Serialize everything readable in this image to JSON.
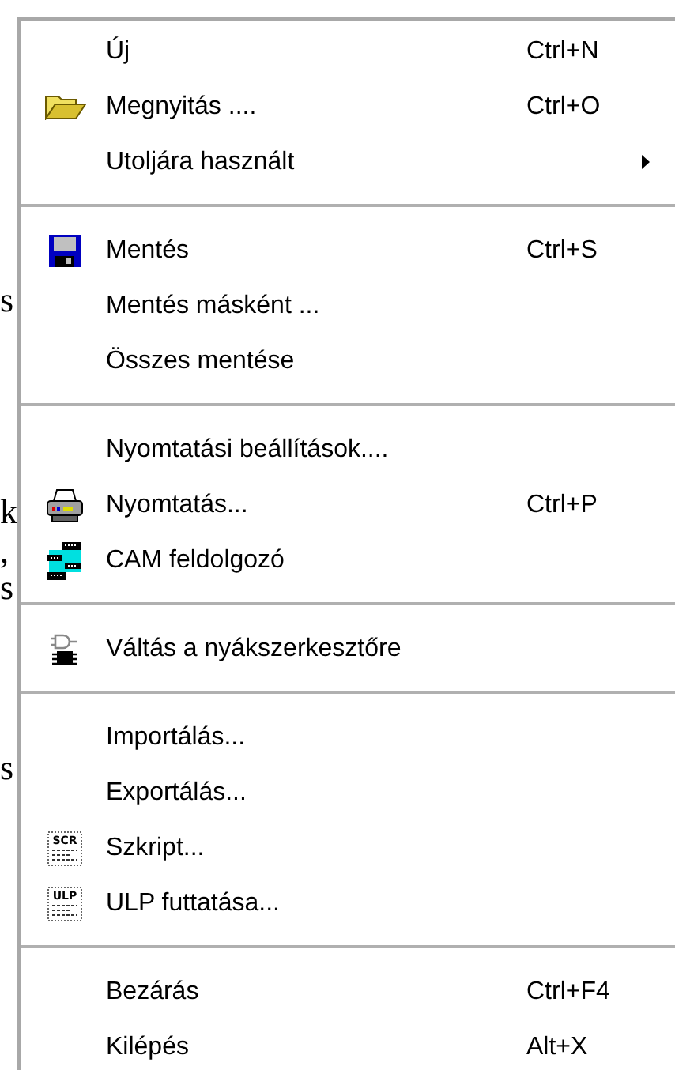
{
  "background_text": [
    "s",
    "k",
    ",",
    "s",
    "s"
  ],
  "menu": {
    "groups": [
      [
        {
          "label": "Új",
          "shortcut": "Ctrl+N",
          "has_submenu": false
        },
        {
          "label": "Megnyitás ....",
          "shortcut": "Ctrl+O",
          "has_submenu": false,
          "kind": "folder"
        },
        {
          "label": "Utoljára használt",
          "has_submenu": true
        }
      ],
      [
        {
          "label": "Mentés",
          "shortcut": "Ctrl+S",
          "has_submenu": false,
          "kind": "floppy"
        },
        {
          "label": "Mentés másként ...",
          "has_submenu": false
        },
        {
          "label": "Összes mentése",
          "has_submenu": false
        }
      ],
      [
        {
          "label": "Nyomtatási beállítások....",
          "has_submenu": false
        },
        {
          "label": "Nyomtatás...",
          "shortcut": "Ctrl+P",
          "has_submenu": false,
          "kind": "printer"
        },
        {
          "label": "CAM feldolgozó",
          "has_submenu": false,
          "kind": "film"
        }
      ],
      [
        {
          "label": "Váltás a nyákszerkesztőre",
          "has_submenu": false,
          "kind": "chip"
        }
      ],
      [
        {
          "label": "Importálás...",
          "has_submenu": false
        },
        {
          "label": "Exportálás...",
          "has_submenu": false
        },
        {
          "label": "Szkript...",
          "has_submenu": false,
          "kind": "script",
          "icon_text": "SCR"
        },
        {
          "label": "ULP futtatása...",
          "has_submenu": false,
          "kind": "script",
          "icon_text": "ULP"
        }
      ],
      [
        {
          "label": "Bezárás",
          "shortcut": "Ctrl+F4",
          "has_submenu": false
        },
        {
          "label": "Kilépés",
          "shortcut": "Alt+X",
          "has_submenu": false
        }
      ]
    ]
  }
}
